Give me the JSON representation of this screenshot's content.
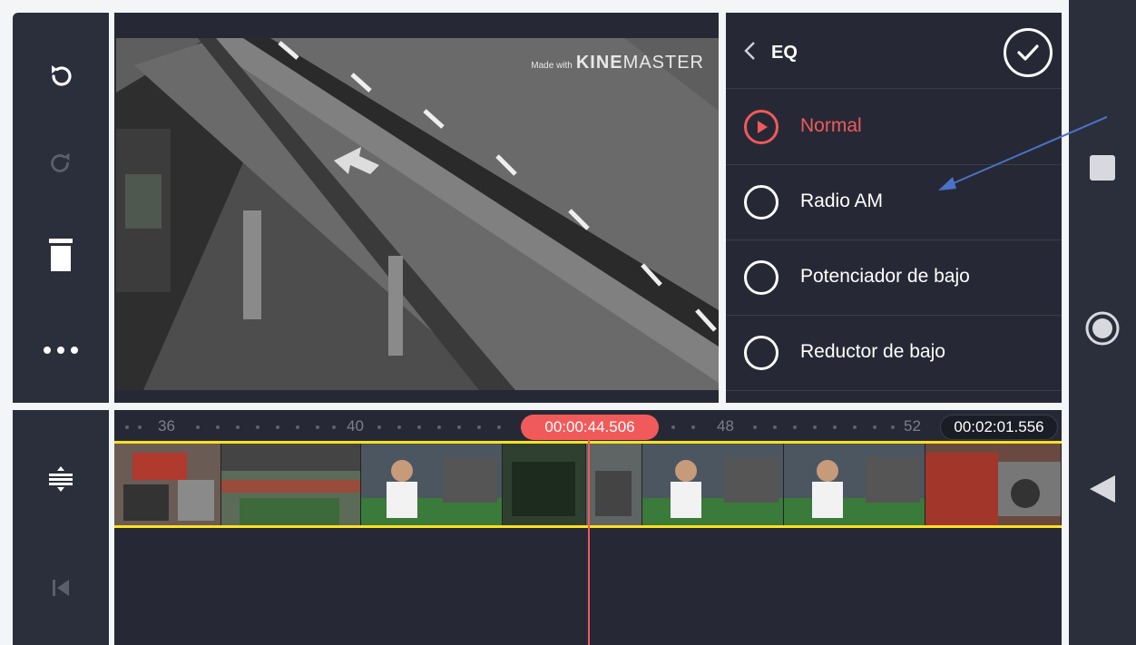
{
  "watermark": {
    "small": "Made with",
    "brand_bold": "KINE",
    "brand_thin": "MASTER"
  },
  "eq": {
    "title": "EQ",
    "options": [
      {
        "label": "Normal",
        "selected": true
      },
      {
        "label": "Radio AM",
        "selected": false
      },
      {
        "label": "Potenciador de bajo",
        "selected": false
      },
      {
        "label": "Reductor de bajo",
        "selected": false
      }
    ]
  },
  "timeline": {
    "ruler": [
      "36",
      "40",
      "48",
      "52"
    ],
    "current_time": "00:00:44.506",
    "total_time": "00:02:01.556"
  },
  "colors": {
    "accent": "#f15a5a",
    "panel": "#262935",
    "track_border": "#ffe021",
    "annotation_arrow": "#4a72c8"
  },
  "icons": {
    "left_toolbar": [
      "undo-icon",
      "redo-icon",
      "trash-icon",
      "more-icon",
      "expand-track-icon",
      "skip-start-icon"
    ],
    "navbar": [
      "stop-icon",
      "home-circle-icon",
      "back-triangle-icon"
    ]
  }
}
